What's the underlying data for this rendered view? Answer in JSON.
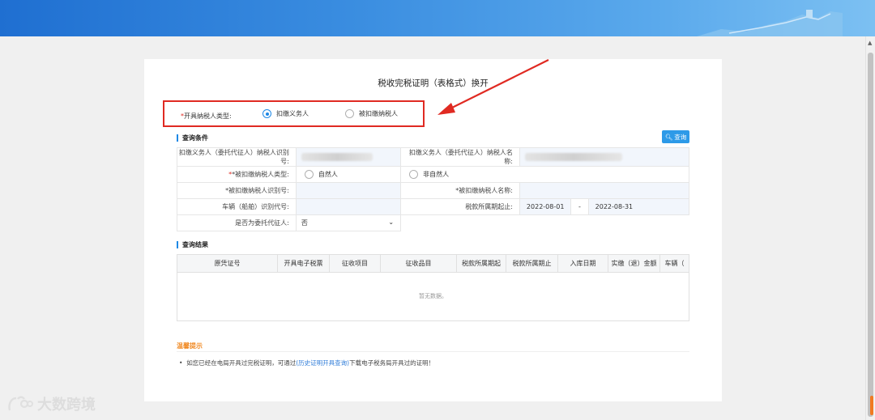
{
  "page": {
    "title": "税收完税证明（表格式）换开"
  },
  "taxpayer_type": {
    "required_mark": "*",
    "label": "开具纳税人类型:",
    "options": [
      "扣缴义务人",
      "被扣缴纳税人"
    ],
    "selected": "扣缴义务人"
  },
  "query": {
    "section_title": "查询条件",
    "search_button": "查询",
    "withholder_id_label": "扣缴义务人（委托代征人）纳税人识别号:",
    "withholder_name_label": "扣缴义务人（委托代征人）纳税人名称:",
    "withheld_type_label": "*被扣缴纳税人类型:",
    "withheld_type_options": [
      "自然人",
      "非自然人"
    ],
    "withheld_id_label": "*被扣缴纳税人识别号:",
    "withheld_name_label": "*被扣缴纳税人名称:",
    "vehicle_label": "车辆（船舶）识别代号:",
    "period_label": "税款所属期起止:",
    "period_start": "2022-08-01",
    "period_sep": "-",
    "period_end": "2022-08-31",
    "agent_label": "是否为委托代征人:",
    "agent_value": "否"
  },
  "results": {
    "section_title": "查询结果",
    "columns": [
      "原凭证号",
      "开具电子税票",
      "征收项目",
      "征收品目",
      "税款所属期起",
      "税款所属期止",
      "入库日期",
      "实缴（退）金额",
      "车辆（"
    ],
    "empty_text": "暂无数据。"
  },
  "tips": {
    "title": "温馨提示",
    "bullet": "•",
    "text_before": "如您已经在电局开具过完税证明，可通过",
    "link": "(历史证明开具查询)",
    "text_after": "下载电子税务局开具过的证明！"
  },
  "watermark": {
    "text": "大数跨境"
  },
  "colors": {
    "accent": "#1e88e5",
    "highlight_box": "#e02a22",
    "tips_title": "#f08a24"
  }
}
